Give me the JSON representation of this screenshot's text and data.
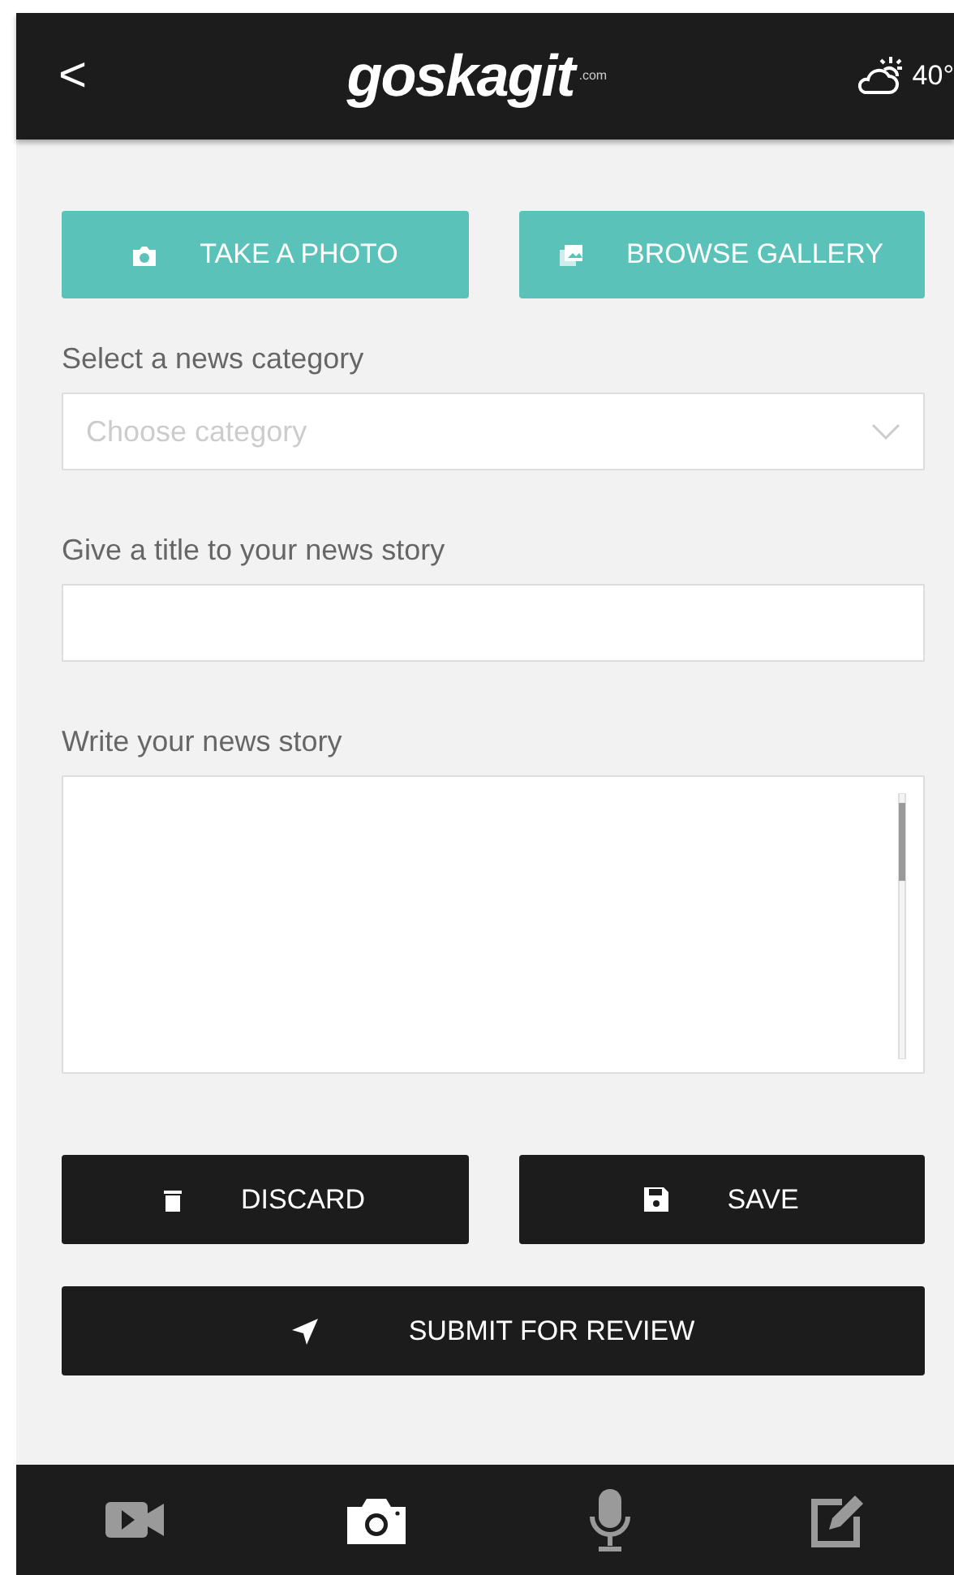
{
  "header": {
    "back": "<",
    "logo": "goskagit",
    "logo_suffix": ".com",
    "temperature": "40°"
  },
  "media_buttons": [
    {
      "kind": "camera",
      "label": "TAKE A PHOTO"
    },
    {
      "kind": "gallery",
      "label": "BROWSE GALLERY"
    }
  ],
  "category": {
    "label": "Select a news category",
    "placeholder": "Choose category"
  },
  "title_field": {
    "label": "Give a title to your news story"
  },
  "story_field": {
    "label": "Write your news story"
  },
  "action_buttons": [
    {
      "kind": "trash",
      "label": "DISCARD"
    },
    {
      "kind": "save",
      "label": "SAVE"
    }
  ],
  "submit_button": {
    "kind": "send",
    "label": "SUBMIT FOR REVIEW"
  },
  "bottom_nav": [
    {
      "kind": "video",
      "selected": false
    },
    {
      "kind": "camera",
      "selected": true
    },
    {
      "kind": "mic",
      "selected": false
    },
    {
      "kind": "edit",
      "selected": false
    }
  ]
}
